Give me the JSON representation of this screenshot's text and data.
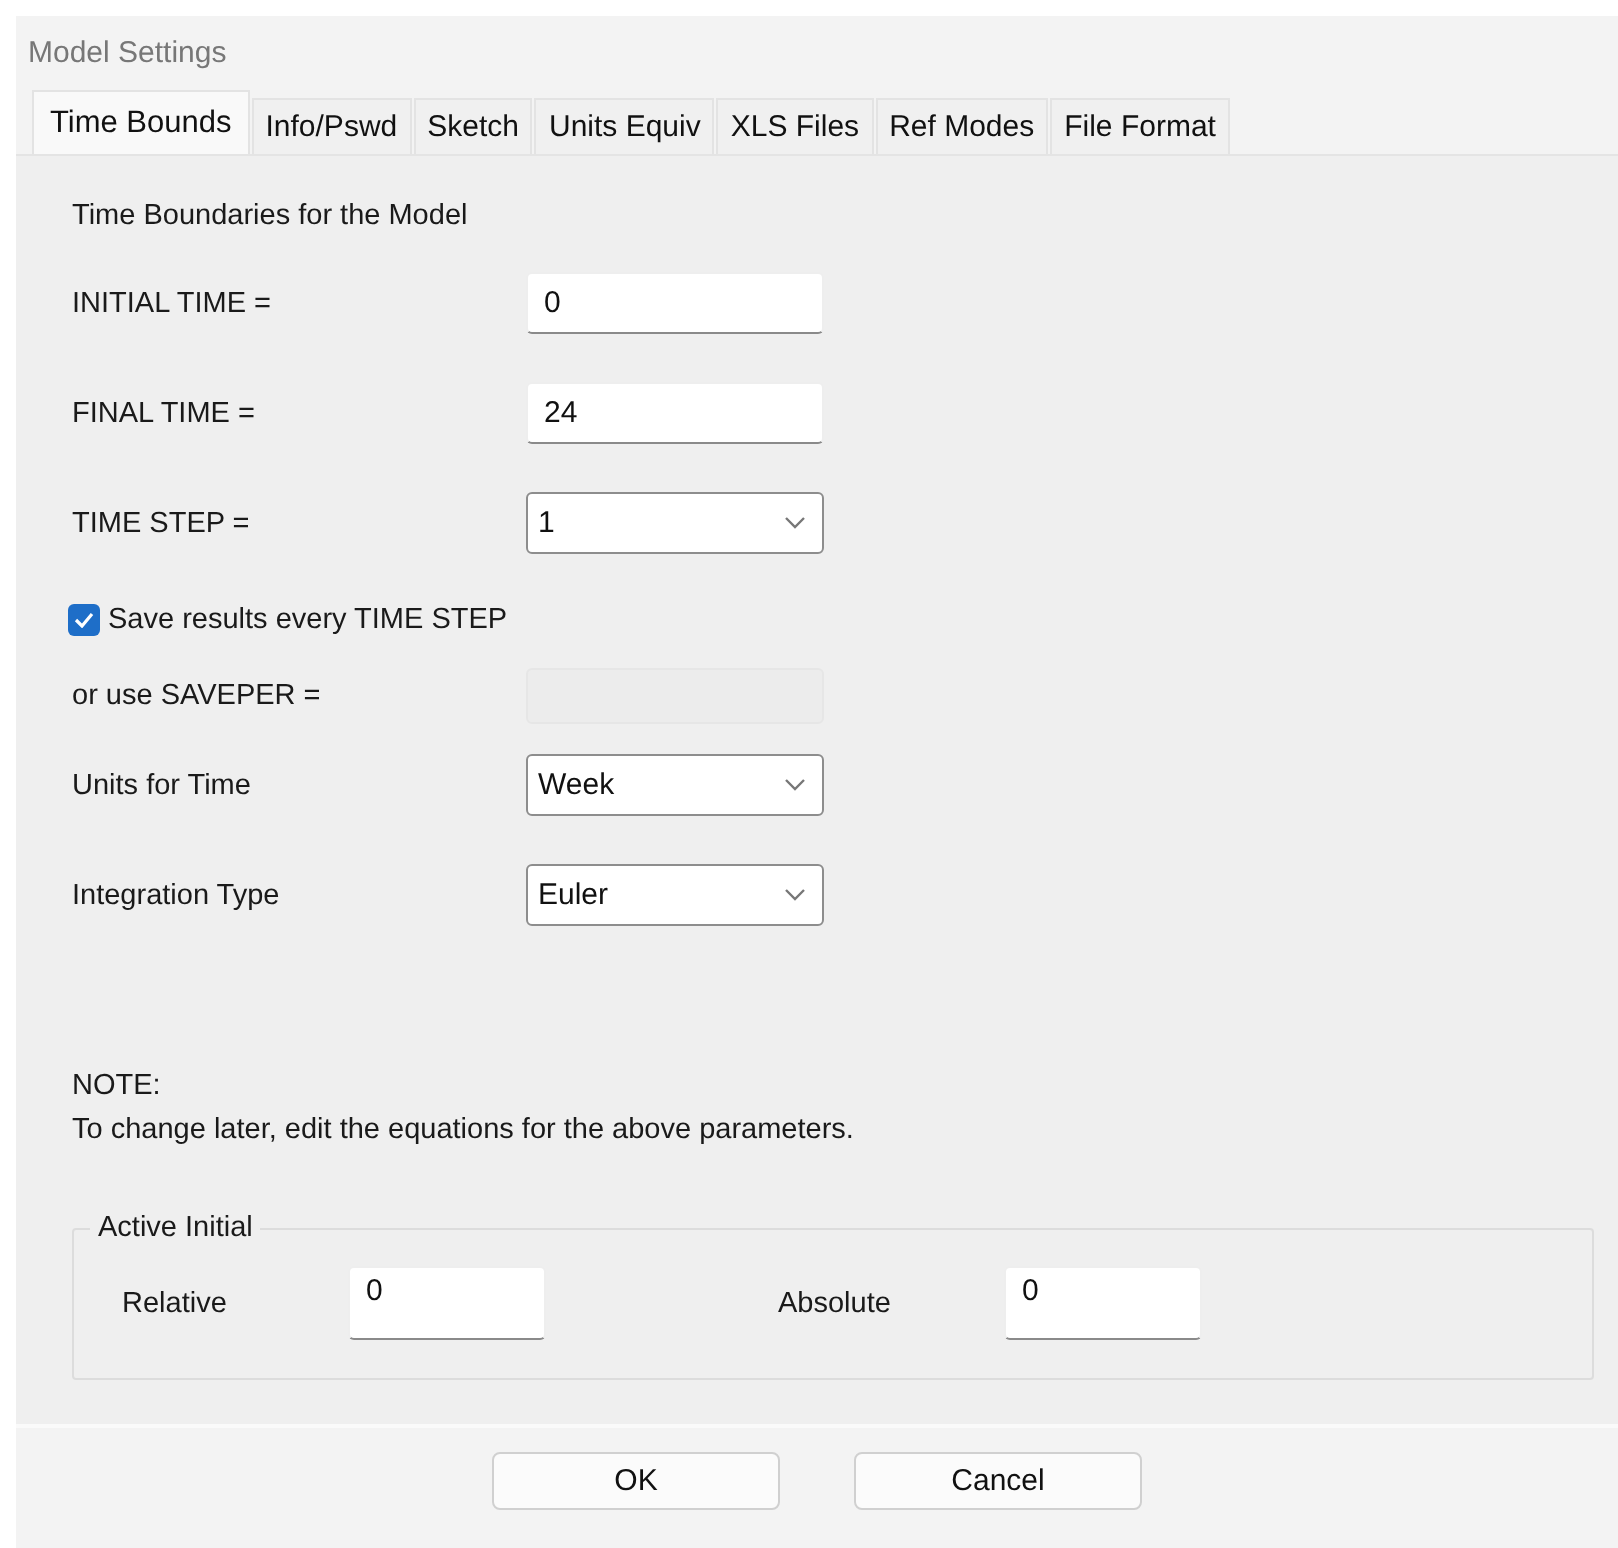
{
  "window": {
    "title": "Model Settings"
  },
  "tabs": [
    {
      "label": "Time Bounds",
      "selected": true
    },
    {
      "label": "Info/Pswd",
      "selected": false
    },
    {
      "label": "Sketch",
      "selected": false
    },
    {
      "label": "Units Equiv",
      "selected": false
    },
    {
      "label": "XLS Files",
      "selected": false
    },
    {
      "label": "Ref Modes",
      "selected": false
    },
    {
      "label": "File Format",
      "selected": false
    }
  ],
  "section_title": "Time Boundaries for the Model",
  "fields": [
    {
      "kind": "text",
      "label": "INITIAL TIME =",
      "value": "0",
      "disabled": false
    },
    {
      "kind": "text",
      "label": "FINAL TIME =",
      "value": "24",
      "disabled": false
    },
    {
      "kind": "dropdown",
      "label": "TIME STEP =",
      "value": "1",
      "disabled": false
    },
    {
      "kind": "checkbox",
      "label": "Save results every TIME STEP",
      "checked": true,
      "disabled": false
    },
    {
      "kind": "text",
      "label": "or use SAVEPER =",
      "disabled": true
    },
    {
      "kind": "dropdown",
      "label": "Units for Time",
      "value": "Week",
      "disabled": false
    },
    {
      "kind": "dropdown",
      "label": "Integration Type",
      "value": "Euler",
      "disabled": false
    }
  ],
  "note": {
    "heading": "NOTE:",
    "text": "To change later, edit the equations for the above parameters."
  },
  "active_initial": {
    "title": "Active Initial",
    "fields": [
      {
        "label": "Relative",
        "value": "0"
      },
      {
        "label": "Absolute",
        "value": "0"
      }
    ]
  },
  "buttons": [
    "OK",
    "Cancel"
  ]
}
